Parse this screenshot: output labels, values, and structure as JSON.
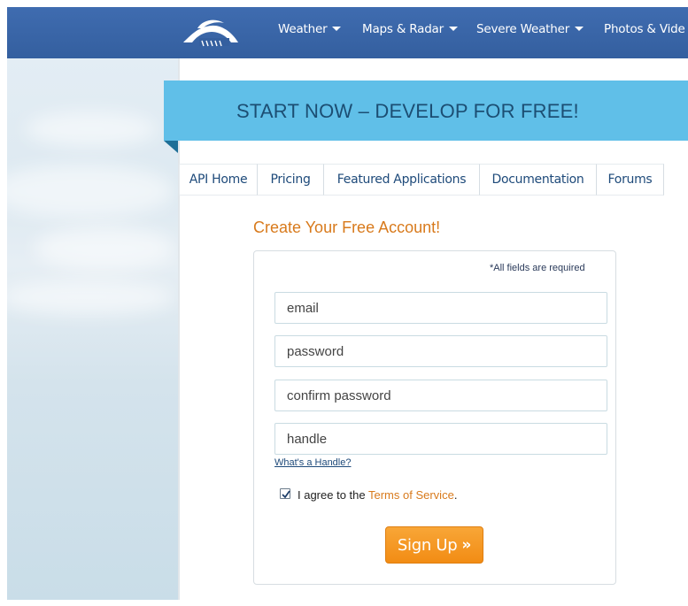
{
  "nav": {
    "logo": "weather-underground-logo",
    "items": [
      {
        "label": "Weather",
        "icon": "caret-down-icon"
      },
      {
        "label": "Maps & Radar",
        "icon": "caret-down-icon"
      },
      {
        "label": "Severe Weather",
        "icon": "caret-down-icon"
      },
      {
        "label": "Photos & Vide"
      }
    ]
  },
  "banner": {
    "text": "START NOW – DEVELOP FOR FREE!"
  },
  "tabs": [
    {
      "label": "API Home"
    },
    {
      "label": "Pricing"
    },
    {
      "label": "Featured Applications"
    },
    {
      "label": "Documentation"
    },
    {
      "label": "Forums"
    }
  ],
  "form": {
    "heading": "Create Your Free Account!",
    "required_note": "*All fields are required",
    "email_placeholder": "email",
    "password_placeholder": "password",
    "confirm_placeholder": "confirm password",
    "handle_placeholder": "handle",
    "handle_help": "What's a Handle?",
    "agree_prefix": "I agree to the ",
    "tos_link": "Terms of Service",
    "agree_suffix": ".",
    "agree_checked": true,
    "submit_label": "Sign Up",
    "submit_icon": "double-chevron-right-icon"
  },
  "colors": {
    "nav_bg": "#3f6cb0",
    "banner_bg": "#60bfe8",
    "accent_orange": "#f28c14",
    "heading_orange": "#d87a1c",
    "link_blue": "#1e4a7a"
  }
}
